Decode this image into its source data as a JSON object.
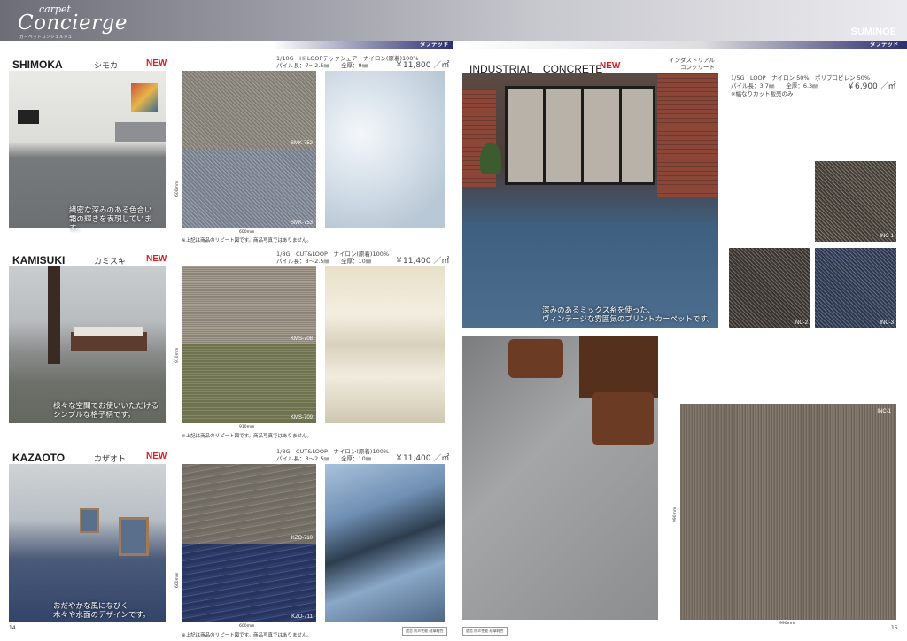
{
  "header": {
    "logo_small": "carpet",
    "logo_big": "Concierge",
    "logo_sub": "カーペットコンシェルジュ",
    "brand": "SUMINOE"
  },
  "bands": {
    "left_label": "タフテッド",
    "right_label": "タフテッド"
  },
  "products": [
    {
      "name": "SHIMOKA",
      "kana": "シモカ",
      "new": "NEW",
      "spec_line1": "1/10G　Hi LOOPテックシェア　ナイロン(原着)100%",
      "spec_line2": "パイル長：7～2.5㎜　　全厚：9㎜",
      "price": "￥11,800 ／㎡",
      "caption_line1": "繊密な深みのある色合いで、",
      "caption_line2": "霜の輝きを表現しています。",
      "code_top": "SMK-752",
      "code_bottom": "SMK-753",
      "dim_w": "600mm",
      "dim_h": "600mm",
      "note": "※上記は商品のリピート図です。商品写真ではありません。"
    },
    {
      "name": "KAMISUKI",
      "kana": "カミスキ",
      "new": "NEW",
      "spec_line1": "1/8G　CUT&LOOP　ナイロン(原着)100%",
      "spec_line2": "パイル長：8～2.5㎜　　全厚：10㎜",
      "price": "￥11,400 ／㎡",
      "caption_line1": "様々な空間でお使いいただける",
      "caption_line2": "シンプルな格子柄です。",
      "code_top": "KMS-708",
      "code_bottom": "KMS-709",
      "dim_w": "910mm",
      "dim_h": "910mm",
      "note": "※上記は商品のリピート図です。商品写真ではありません。"
    },
    {
      "name": "KAZAOTO",
      "kana": "カザオト",
      "new": "NEW",
      "spec_line1": "1/8G　CUT&LOOP　ナイロン(原着)100%",
      "spec_line2": "パイル長：8～2.5㎜　　全厚：10㎜",
      "price": "￥11,400 ／㎡",
      "caption_line1": "おだやかな風になびく",
      "caption_line2": "木々や水面のデザインです。",
      "code_top": "KZO-710",
      "code_bottom": "KZO-711",
      "dim_w": "600mm",
      "dim_h": "600mm",
      "note": "※上記は商品のリピート図です。商品写真ではありません。"
    }
  ],
  "industrial": {
    "name": "INDUSTRIAL　CONCRETE",
    "new": "NEW",
    "kana_line1": "インダストリアル",
    "kana_line2": "コンクリート",
    "spec_line1": "1/5G　LOOP　ナイロン 50%　ポリプロピレン 50%",
    "spec_line2": "パイル長：3.7㎜　　全厚：6.3㎜",
    "price": "￥6,900 ／㎡",
    "spec_note": "※幅なりカット販売のみ",
    "caption_line1": "深みのあるミックス糸を使った、",
    "caption_line2": "ヴィンテージな雰囲気のプリントカーペットです。",
    "swatch1": "INC-1",
    "swatch2": "INC-2",
    "swatch3": "INC-3",
    "big_code": "INC-1",
    "big_dim_w": "990mm",
    "big_dim_h": "990mm"
  },
  "footer": {
    "left_page": "14",
    "right_page": "15",
    "box_label": "遮音 防炎性能 耐摩耗性"
  }
}
